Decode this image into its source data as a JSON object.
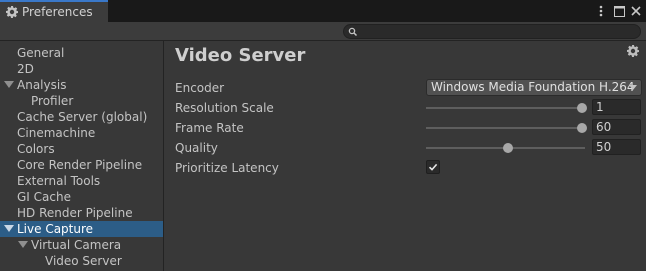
{
  "window": {
    "tab_title": "Preferences",
    "tab_icon": "gear-icon",
    "controls": [
      "more-options-icon",
      "maximize-icon",
      "close-icon"
    ]
  },
  "search": {
    "value": "",
    "icon": "search-icon"
  },
  "sidebar": {
    "items": [
      {
        "label": "General",
        "indent": 0,
        "expandable": false,
        "selected": false
      },
      {
        "label": "2D",
        "indent": 0,
        "expandable": false,
        "selected": false
      },
      {
        "label": "Analysis",
        "indent": 0,
        "expandable": true,
        "expanded": true,
        "selected": false
      },
      {
        "label": "Profiler",
        "indent": 1,
        "expandable": false,
        "selected": false
      },
      {
        "label": "Cache Server (global)",
        "indent": 0,
        "expandable": false,
        "selected": false
      },
      {
        "label": "Cinemachine",
        "indent": 0,
        "expandable": false,
        "selected": false
      },
      {
        "label": "Colors",
        "indent": 0,
        "expandable": false,
        "selected": false
      },
      {
        "label": "Core Render Pipeline",
        "indent": 0,
        "expandable": false,
        "selected": false
      },
      {
        "label": "External Tools",
        "indent": 0,
        "expandable": false,
        "selected": false
      },
      {
        "label": "GI Cache",
        "indent": 0,
        "expandable": false,
        "selected": false
      },
      {
        "label": "HD Render Pipeline",
        "indent": 0,
        "expandable": false,
        "selected": false
      },
      {
        "label": "Live Capture",
        "indent": 0,
        "expandable": true,
        "expanded": true,
        "selected": true
      },
      {
        "label": "Virtual Camera",
        "indent": 1,
        "expandable": true,
        "expanded": true,
        "selected": false
      },
      {
        "label": "Video Server",
        "indent": 2,
        "expandable": false,
        "selected": false
      }
    ]
  },
  "content": {
    "title": "Video Server",
    "settings_icon": "gear-icon",
    "fields": {
      "encoder": {
        "label": "Encoder",
        "value": "Windows Media Foundation H.264"
      },
      "resolution_scale": {
        "label": "Resolution Scale",
        "value": "1",
        "slider_fraction": 1.0
      },
      "frame_rate": {
        "label": "Frame Rate",
        "value": "60",
        "slider_fraction": 1.0
      },
      "quality": {
        "label": "Quality",
        "value": "50",
        "slider_fraction": 0.5
      },
      "prioritize_latency": {
        "label": "Prioritize Latency",
        "checked": true
      }
    }
  },
  "colors": {
    "background": "#383838",
    "selection": "#2c5d87",
    "tab_accent": "#3a78c9",
    "titlebar": "#191919"
  }
}
